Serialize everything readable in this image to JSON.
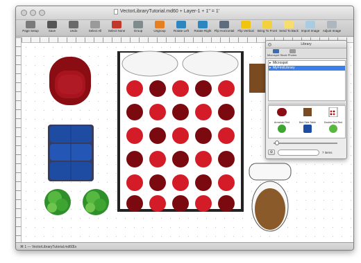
{
  "window": {
    "title": "VectorLibraryTutorial.md60 + Layer-1 + 1\" = 1'"
  },
  "toolbar": {
    "items": [
      {
        "label": "Page Setup",
        "icon": "page-setup-icon",
        "color": "#7a7a7a"
      },
      {
        "label": "Save",
        "icon": "save-icon",
        "color": "#555555"
      },
      {
        "label": "Undo",
        "icon": "undo-icon",
        "color": "#6a6a6a"
      },
      {
        "label": "Select All",
        "icon": "select-all-icon",
        "color": "#9a9a9a"
      },
      {
        "label": "Select None",
        "icon": "select-none-icon",
        "color": "#c0392b"
      },
      {
        "label": "Group",
        "icon": "group-icon",
        "color": "#7f8c8d"
      },
      {
        "label": "Ungroup",
        "icon": "ungroup-icon",
        "color": "#e67e22"
      },
      {
        "label": "Rotate Left",
        "icon": "rotate-left-icon",
        "color": "#2e86c1"
      },
      {
        "label": "Rotate Right",
        "icon": "rotate-right-icon",
        "color": "#2e86c1"
      },
      {
        "label": "Flip Horizontal",
        "icon": "flip-horizontal-icon",
        "color": "#5d6d7e"
      },
      {
        "label": "Flip Vertical",
        "icon": "flip-vertical-icon",
        "color": "#f1c40f"
      },
      {
        "label": "Bring To Front",
        "icon": "bring-to-front-icon",
        "color": "#f4d03f"
      },
      {
        "label": "Send To Back",
        "icon": "send-to-back-icon",
        "color": "#f7dc6f"
      },
      {
        "label": "Import Image",
        "icon": "import-image-icon",
        "color": "#a9cce3"
      },
      {
        "label": "Adjust Image",
        "icon": "adjust-image-icon",
        "color": "#aeb6bf"
      }
    ]
  },
  "library": {
    "title": "Library",
    "tabs": [
      {
        "label": "Microspot Stock",
        "icon": "microspot-stock-icon"
      },
      {
        "label": "Photos",
        "icon": "photos-icon"
      }
    ],
    "tree": [
      {
        "label": "Microspot",
        "selected": false
      },
      {
        "label": "MyFirstLibrary",
        "selected": true
      }
    ],
    "items": [
      "Armchair Red",
      "Bed Side Table",
      "Double Bed Red",
      "",
      "",
      ""
    ],
    "count_text": "7 items"
  },
  "status": {
    "left": "⌘ 1 — VectorLibraryTutorial.md60",
    "zoom": "1x"
  }
}
